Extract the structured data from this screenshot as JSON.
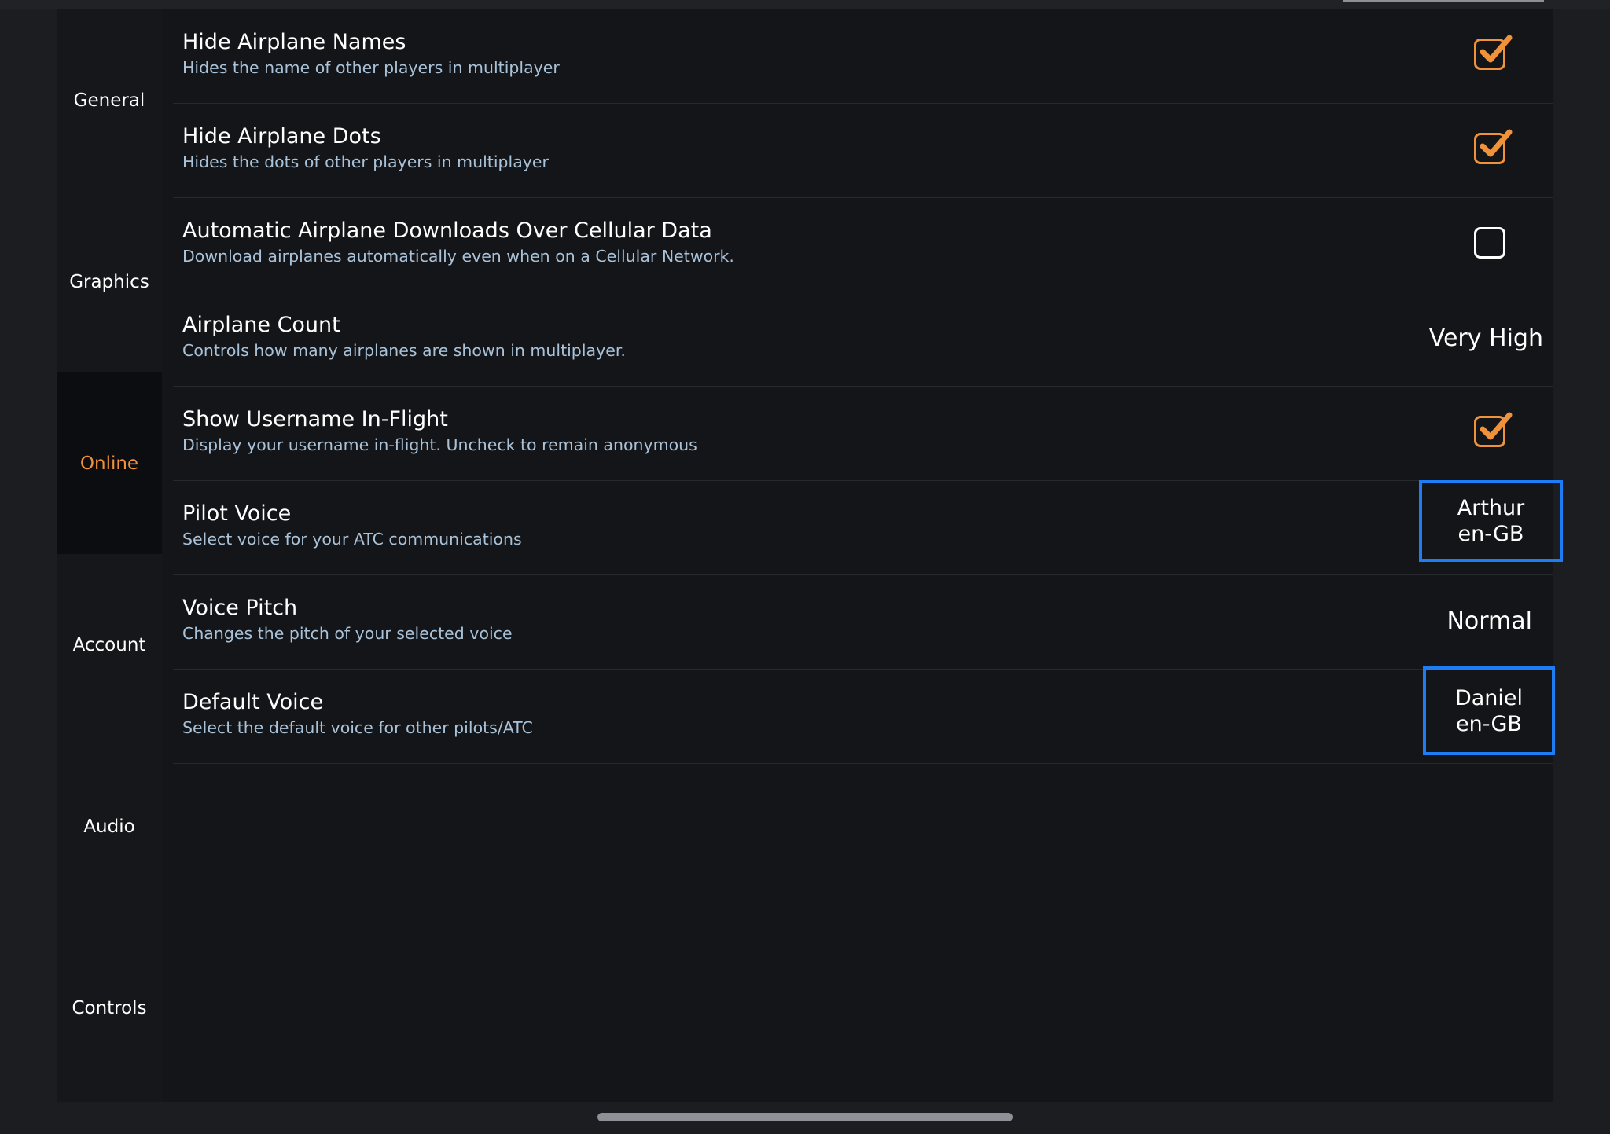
{
  "sidebar": {
    "items": [
      {
        "label": "General"
      },
      {
        "label": "Graphics"
      },
      {
        "label": "Online"
      },
      {
        "label": "Account"
      },
      {
        "label": "Audio"
      },
      {
        "label": "Controls"
      }
    ],
    "active": "Online"
  },
  "settings": {
    "hide_names": {
      "title": "Hide Airplane Names",
      "desc": "Hides the name of other players in multiplayer",
      "checked": true
    },
    "hide_dots": {
      "title": "Hide Airplane Dots",
      "desc": "Hides the dots of other players in multiplayer",
      "checked": true
    },
    "auto_downloads": {
      "title": "Automatic Airplane Downloads Over Cellular Data",
      "desc": "Download airplanes automatically even when on a Cellular Network.",
      "checked": false
    },
    "airplane_count": {
      "title": "Airplane Count",
      "desc": "Controls how many airplanes are shown in multiplayer.",
      "value": "Very High"
    },
    "show_username": {
      "title": "Show Username In-Flight",
      "desc": "Display your username in-flight. Uncheck to remain anonymous",
      "checked": true
    },
    "pilot_voice": {
      "title": "Pilot Voice",
      "desc": "Select voice for your ATC communications",
      "voice_name": "Arthur",
      "voice_locale": "en-GB"
    },
    "voice_pitch": {
      "title": "Voice Pitch",
      "desc": "Changes the pitch of your selected voice",
      "value": "Normal"
    },
    "default_voice": {
      "title": "Default Voice",
      "desc": "Select the default voice for other pilots/ATC",
      "voice_name": "Daniel",
      "voice_locale": "en-GB"
    }
  },
  "colors": {
    "accent": "#f0923a",
    "highlight": "#1e7cf5",
    "panel": "#141519",
    "description": "#a9c2d8"
  },
  "icons": {
    "checked": "checkmark-icon"
  }
}
